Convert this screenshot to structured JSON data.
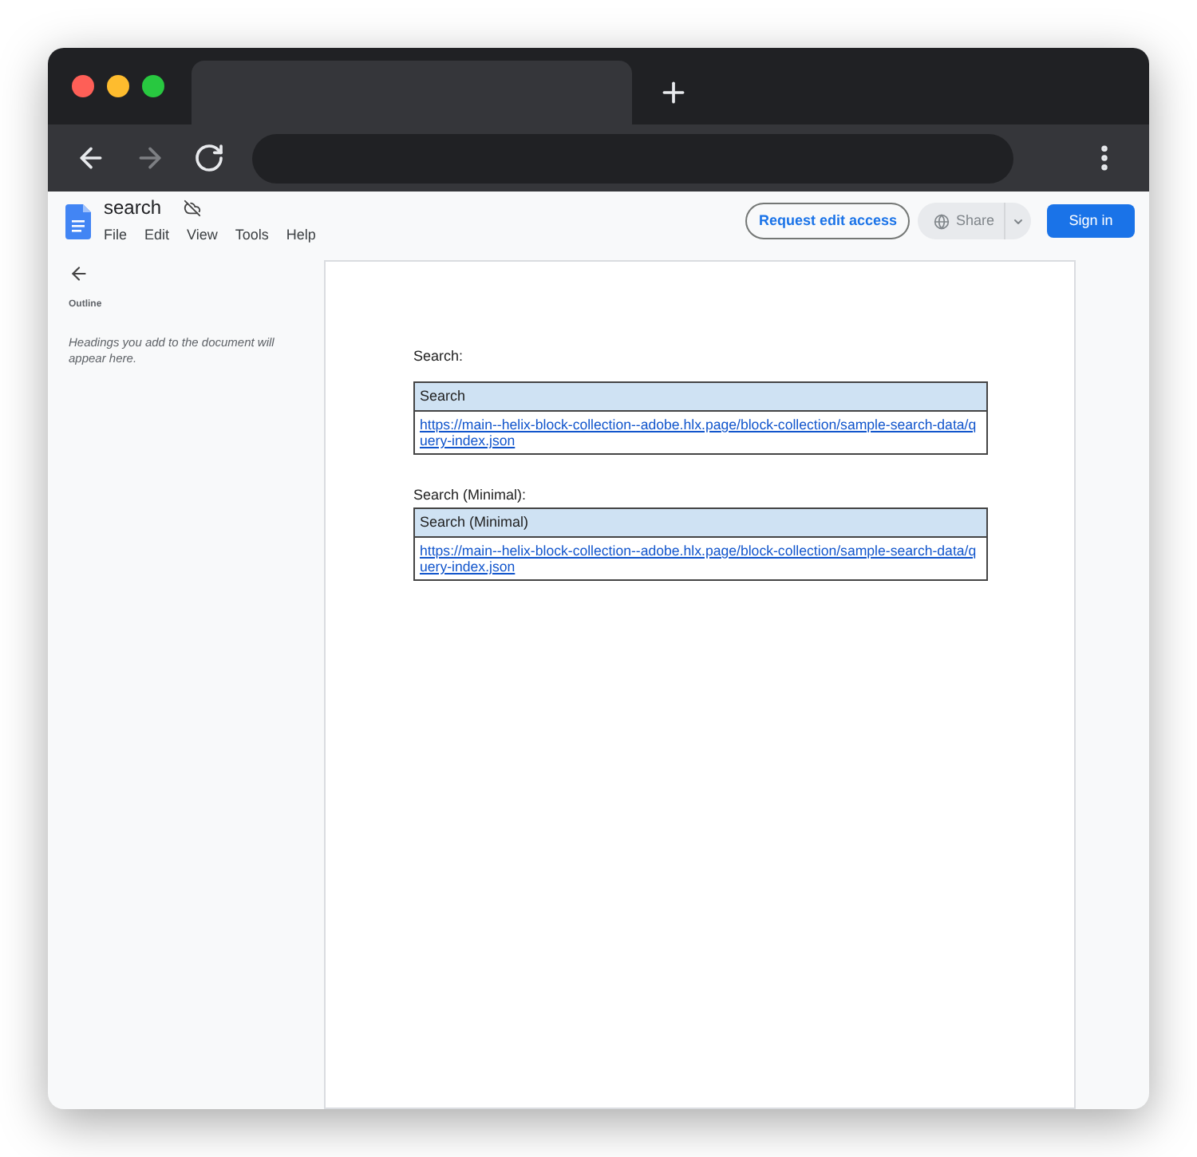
{
  "browser": {
    "nav_buttons": [
      {
        "kind": "back",
        "disabled": false
      },
      {
        "kind": "forward",
        "disabled": true
      },
      {
        "kind": "reload",
        "disabled": false
      }
    ]
  },
  "docs": {
    "title": "search",
    "menu": [
      "File",
      "Edit",
      "View",
      "Tools",
      "Help"
    ],
    "request_button": "Request edit access",
    "share_button": "Share",
    "sign_in_button": "Sign in"
  },
  "outline": {
    "heading": "Outline",
    "hint": "Headings you add to the document will appear here."
  },
  "document": {
    "blocks": [
      {
        "label": "Search:",
        "table_header": "Search",
        "link": "https://main--helix-block-collection--adobe.hlx.page/block-collection/sample-search-data/query-index.json"
      },
      {
        "label": "Search (Minimal):",
        "table_header": "Search (Minimal)",
        "link": "https://main--helix-block-collection--adobe.hlx.page/block-collection/sample-search-data/query-index.json"
      }
    ]
  }
}
